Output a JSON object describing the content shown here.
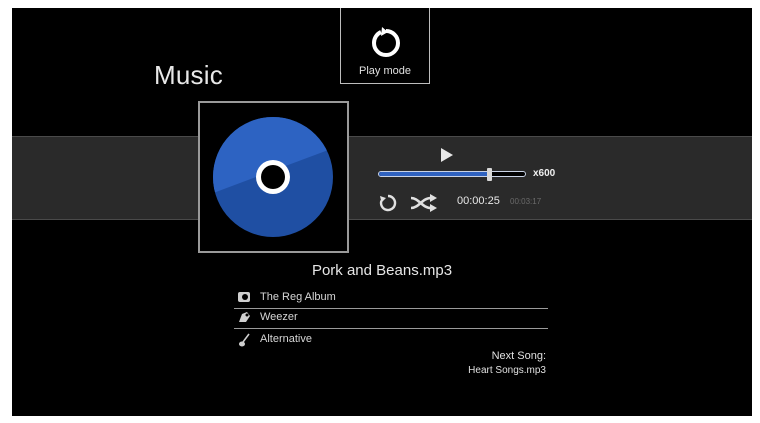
{
  "header": {
    "title": "Music"
  },
  "play_mode": {
    "label": "Play mode",
    "icon": "repeat-icon"
  },
  "player": {
    "play_icon": "play-icon",
    "progress": 0.75,
    "speed": "x600",
    "elapsed": "00:00:25",
    "total": "00:03:17",
    "repeat_icon": "repeat-icon",
    "shuffle_icon": "shuffle-icon"
  },
  "album_art": {
    "icon": "disc-icon",
    "color": "#1d4fa6"
  },
  "song": {
    "title": "Pork and Beans.mp3",
    "album": "The Reg Album",
    "artist": "Weezer",
    "genre": "Alternative"
  },
  "next": {
    "label": "Next Song:",
    "value": "Heart Songs.mp3"
  },
  "colors": {
    "background": "#000000",
    "band": "#2a2a2a",
    "accent": "#2f62c0"
  }
}
